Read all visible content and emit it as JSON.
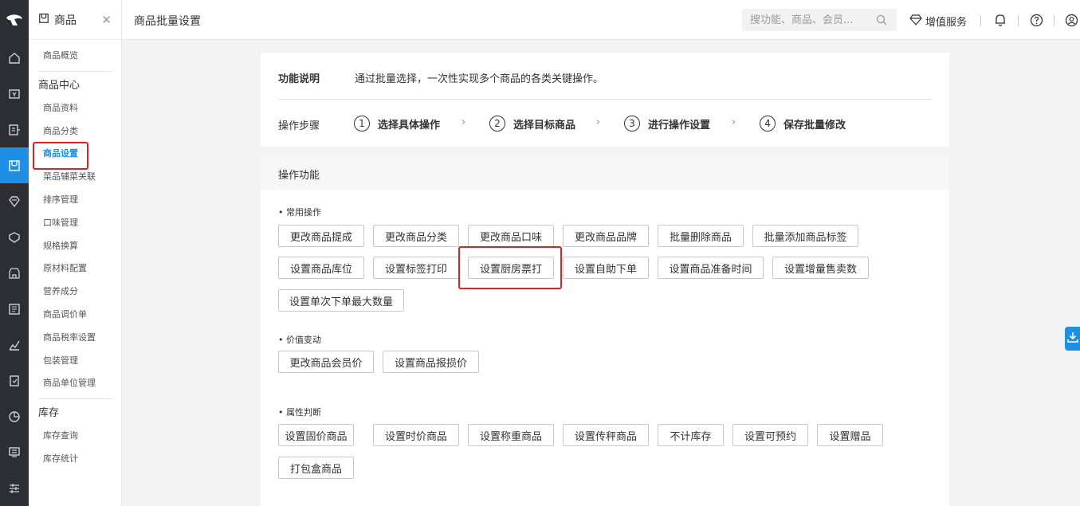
{
  "sidebar": {
    "module_title": "商品",
    "groups": [
      {
        "title": "",
        "items": [
          "商品概览"
        ]
      },
      {
        "title": "商品中心",
        "items": [
          "商品资料",
          "商品分类",
          "商品设置",
          "菜品辅菜关联",
          "排序管理",
          "口味管理",
          "规格换算",
          "原材料配置",
          "营养成分",
          "商品调价单",
          "商品税率设置",
          "包装管理",
          "商品单位管理"
        ]
      },
      {
        "title": "库存",
        "items": [
          "库存查询",
          "库存统计"
        ]
      }
    ],
    "active_item": "商品设置"
  },
  "header": {
    "page_title": "商品批量设置",
    "search_placeholder": "搜功能、商品、会员...",
    "value_added_label": "增值服务"
  },
  "intro": {
    "func_label": "功能说明",
    "func_desc": "通过批量选择，一次性实现多个商品的各类关键操作。",
    "steps_label": "操作步骤",
    "steps": [
      {
        "num": "1",
        "label": "选择具体操作"
      },
      {
        "num": "2",
        "label": "选择目标商品"
      },
      {
        "num": "3",
        "label": "进行操作设置"
      },
      {
        "num": "4",
        "label": "保存批量修改"
      }
    ]
  },
  "operations": {
    "title": "操作功能",
    "sections": [
      {
        "title": "• 常用操作",
        "buttons": [
          "更改商品提成",
          "更改商品分类",
          "更改商品口味",
          "更改商品品牌",
          "批量删除商品",
          "批量添加商品标签",
          "设置商品库位",
          "设置标签打印",
          "设置厨房票打",
          "设置自助下单",
          "设置商品准备时间",
          "设置增量售卖数",
          "设置单次下单最大数量"
        ]
      },
      {
        "title": "• 价值变动",
        "buttons": [
          "更改商品会员价",
          "设置商品报损价"
        ]
      },
      {
        "title": "• 属性判断",
        "buttons": [
          "设置固价商品",
          "设置时价商品",
          "设置称重商品",
          "设置传秤商品",
          "不计库存",
          "设置可预约",
          "设置赠品",
          "打包盒商品"
        ]
      }
    ],
    "highlighted_button": "设置厨房票打"
  },
  "colors": {
    "accent": "#1f8fe5",
    "highlight": "#e02020",
    "rail_bg": "#2b2e33"
  }
}
